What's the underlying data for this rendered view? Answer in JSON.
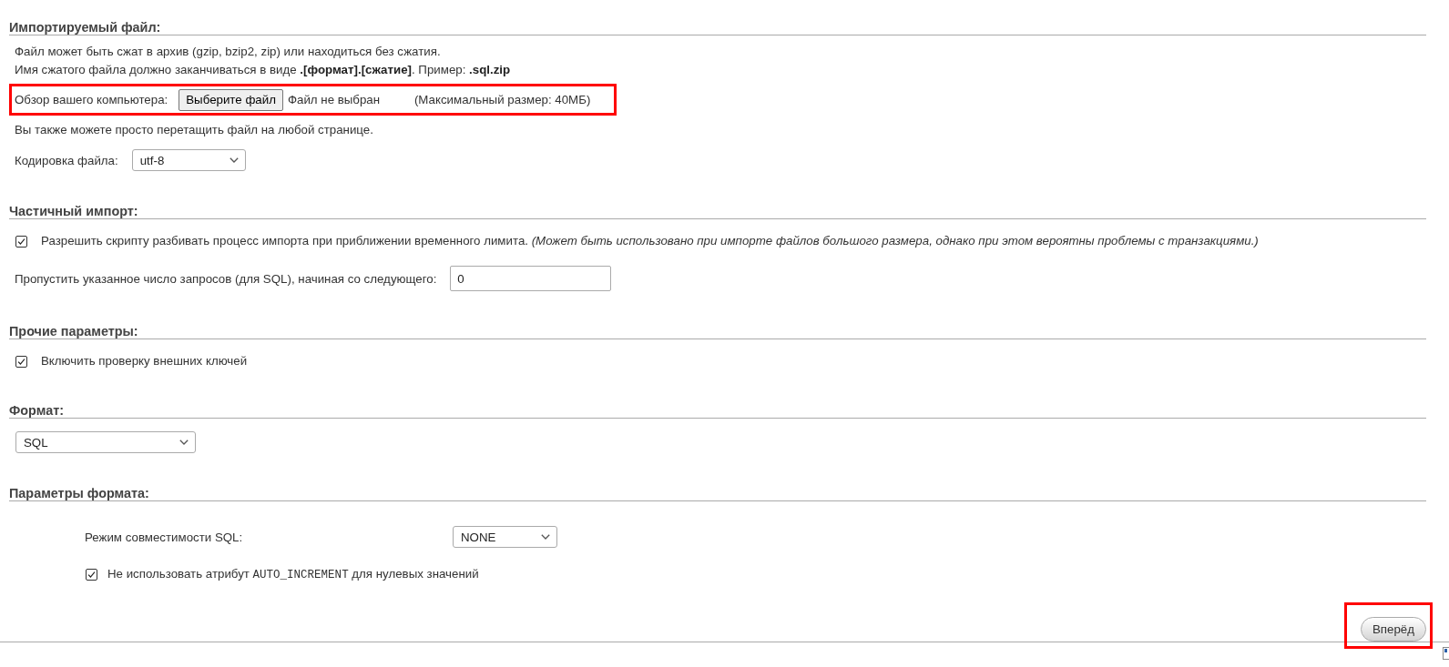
{
  "sections": [
    {
      "title": "Импортируемый файл:",
      "indented": false,
      "items": [
        {
          "kind": "note",
          "text": "Файл может быть сжат в архив (gzip, bzip2, zip) или находиться без сжатия."
        },
        {
          "kind": "note",
          "text": "Имя сжатого файла должно заканчиваться в виде **.[формат].[сжатие]**. Пример: **.sql.zip**"
        },
        {
          "kind": "file",
          "label": "Обзор вашего компьютера:",
          "button": "Выберите файл",
          "status": "Файл не выбран",
          "limit": "(Максимальный размер: 40МБ)",
          "highlighted": true
        },
        {
          "kind": "note",
          "text": "Вы также можете просто перетащить файл на любой странице."
        },
        {
          "kind": "select",
          "label": "Кодировка файла:",
          "value": "utf-8"
        }
      ]
    },
    {
      "title": "Частичный импорт:",
      "indented": false,
      "items": [
        {
          "kind": "checkbox",
          "checked": true,
          "label": "Разрешить скрипту разбивать процесс импорта при приближении временного лимита. *(Может быть использовано при импорте файлов большого размера, однако при этом вероятны проблемы с транзакциями.)*"
        },
        {
          "kind": "number",
          "label": "Пропустить указанное число запросов (для SQL), начиная со следующего:",
          "value": "0"
        }
      ]
    },
    {
      "title": "Прочие параметры:",
      "indented": false,
      "items": [
        {
          "kind": "checkbox",
          "checked": true,
          "label": "Включить проверку внешних ключей"
        }
      ]
    },
    {
      "title": "Формат:",
      "indented": false,
      "items": [
        {
          "kind": "select",
          "value": "SQL"
        }
      ]
    },
    {
      "title": "Параметры формата:",
      "indented": true,
      "items": [
        {
          "kind": "select",
          "label": "Режим совместимости SQL:",
          "value": "NONE"
        },
        {
          "kind": "checkbox",
          "checked": true,
          "label_parts": [
            {
              "kind": "text",
              "text": "Не использовать атрибут "
            },
            {
              "kind": "code",
              "text": "AUTO_INCREMENT"
            },
            {
              "kind": "text",
              "text": " для нулевых значений"
            }
          ]
        }
      ]
    }
  ],
  "submit": {
    "label": "Вперёд",
    "highlighted": true
  }
}
